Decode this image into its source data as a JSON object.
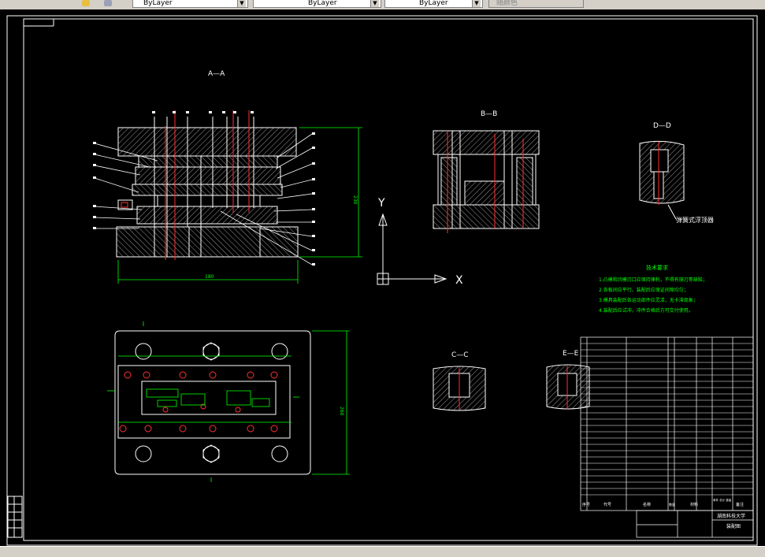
{
  "toolbar": {
    "layer_value": "ByLayer",
    "linetype_value": "ByLayer",
    "lineweight_value": "ByLayer",
    "plotstyle_value": "随颜色"
  },
  "drawing": {
    "view_aa": "A—A",
    "view_bb": "B—B",
    "view_cc": "C—C",
    "view_dd": "D—D",
    "view_ee": "E—E",
    "ejector_note": "弹簧式浮顶器",
    "ucs_y": "Y",
    "ucs_x": "X",
    "tech_title": "技术要求",
    "tech_items": [
      "1.凸模和凹模刃口应保持锋利，不得有崩刃等缺陷；",
      "2.各板间应平行，装配后应保证间隙均匀；",
      "3.模具装配后各运动部件应灵活，无卡滞现象；",
      "4.装配后应试冲，冲件合格后方可交付使用。"
    ],
    "dim_width": "180",
    "dim_height": "230",
    "dim_plate": "260"
  },
  "title_block": {
    "school": "湖南科技大学",
    "drawing_name": "装配图",
    "col_index": "序号",
    "col_code": "代号",
    "col_name": "名称",
    "col_qty": "数量",
    "col_material": "材料",
    "col_weight": "单件 总计 重量",
    "col_remark": "备注"
  },
  "colors": {
    "line": "#ffffff",
    "accent": "#00ff00",
    "red": "#ff3030",
    "cyan": "#00ffff"
  }
}
